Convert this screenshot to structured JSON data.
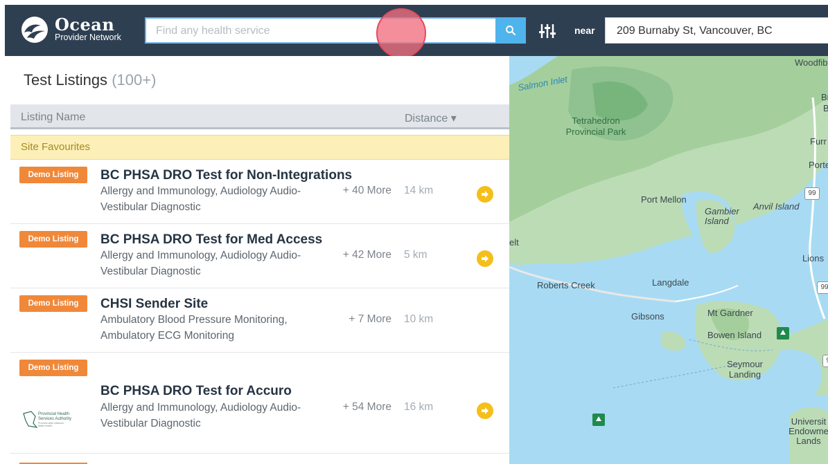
{
  "header": {
    "logo_title": "Ocean",
    "logo_subtitle": "Provider Network",
    "search_placeholder": "Find any health service",
    "near_label": "near",
    "location_value": "209 Burnaby St, Vancouver, BC"
  },
  "list": {
    "title": "Test Listings",
    "count": "(100+)",
    "col_name": "Listing Name",
    "col_distance": "Distance ▾",
    "favourites_label": "Site Favourites",
    "items": [
      {
        "badge": "Demo Listing",
        "name": "BC PHSA DRO Test for Non-Integrations",
        "desc": "Allergy and Immunology, Audiology Audio-Vestibular Diagnostic",
        "more": "+ 40 More",
        "distance": "14 km"
      },
      {
        "badge": "Demo Listing",
        "name": "BC PHSA DRO Test for Med Access",
        "desc": "Allergy and Immunology, Audiology Audio-Vestibular Diagnostic",
        "more": "+ 42 More",
        "distance": "5 km"
      },
      {
        "badge": "Demo Listing",
        "name": "CHSI Sender Site",
        "desc": "Ambulatory Blood Pressure Monitoring, Ambulatory ECG Monitoring",
        "more": "+ 7 More",
        "distance": "10 km"
      },
      {
        "badge": "Demo Listing",
        "name": "BC PHSA DRO Test for Accuro",
        "desc": "Allergy and Immunology, Audiology Audio-Vestibular Diagnostic",
        "more": "+ 54 More",
        "distance": "16 km",
        "org_logo_text": "Provincial Health Services Authority"
      }
    ]
  },
  "map": {
    "labels": {
      "salmon_inlet": "Salmon Inlet",
      "woodfibre": "Woodfibr",
      "tetrahedron": "Tetrahedron Provincial Park",
      "br": "Br",
      "b": "B",
      "furr": "Furr",
      "porte": "Porte",
      "port_mellon": "Port Mellon",
      "gambier": "Gambier Island",
      "anvil": "Anvil Island",
      "lions": "Lions",
      "elt": "elt",
      "roberts_creek": "Roberts Creek",
      "langdale": "Langdale",
      "gibsons": "Gibsons",
      "mt_gardner": "Mt Gardner",
      "bowen": "Bowen Island",
      "seymour": "Seymour Landing",
      "university": "Universit Endowme Lands"
    },
    "highways": [
      "99",
      "99",
      "99"
    ]
  }
}
